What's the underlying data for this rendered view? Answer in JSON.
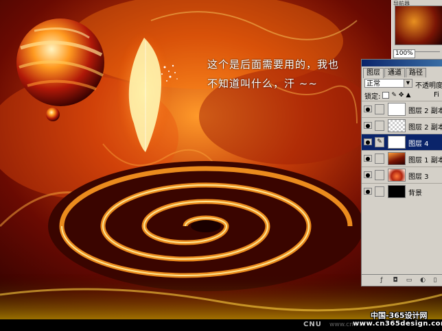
{
  "caption": {
    "line1": "这个是后面需要用的，我也",
    "line2": "不知道叫什么，汗 ~~"
  },
  "navigator": {
    "title": "导航器",
    "zoom": "100%"
  },
  "layers_panel": {
    "tabs": [
      {
        "label": "图层",
        "active": true
      },
      {
        "label": "通道",
        "active": false
      },
      {
        "label": "路径",
        "active": false
      }
    ],
    "blend_mode": "正常",
    "opacity_label": "不透明度",
    "lock_label": "锁定:",
    "fill_label": "Fi",
    "layers": [
      {
        "name": "图层 2 副本",
        "selected": false,
        "thumb": "t1",
        "link": ""
      },
      {
        "name": "图层 2 副本",
        "selected": false,
        "thumb": "t2",
        "link": ""
      },
      {
        "name": "图层 4",
        "selected": true,
        "thumb": "t1",
        "link": "brush-icon"
      },
      {
        "name": "图层 1 副本",
        "selected": false,
        "thumb": "t3",
        "link": ""
      },
      {
        "name": "图层 3",
        "selected": false,
        "thumb": "t4",
        "link": ""
      },
      {
        "name": "背景",
        "selected": false,
        "thumb": "t5",
        "link": ""
      }
    ]
  },
  "watermark": {
    "cnu": "CNU",
    "cnu_site": "www.cnu.cc",
    "site_cn": "中国-365设计网",
    "site_url": "www.cn365design.com"
  },
  "colors": {
    "panel_bg": "#d4d0c8",
    "selection": "#0a246a",
    "fire_orange": "#ff8a1a",
    "deep_red": "#5a0500"
  }
}
